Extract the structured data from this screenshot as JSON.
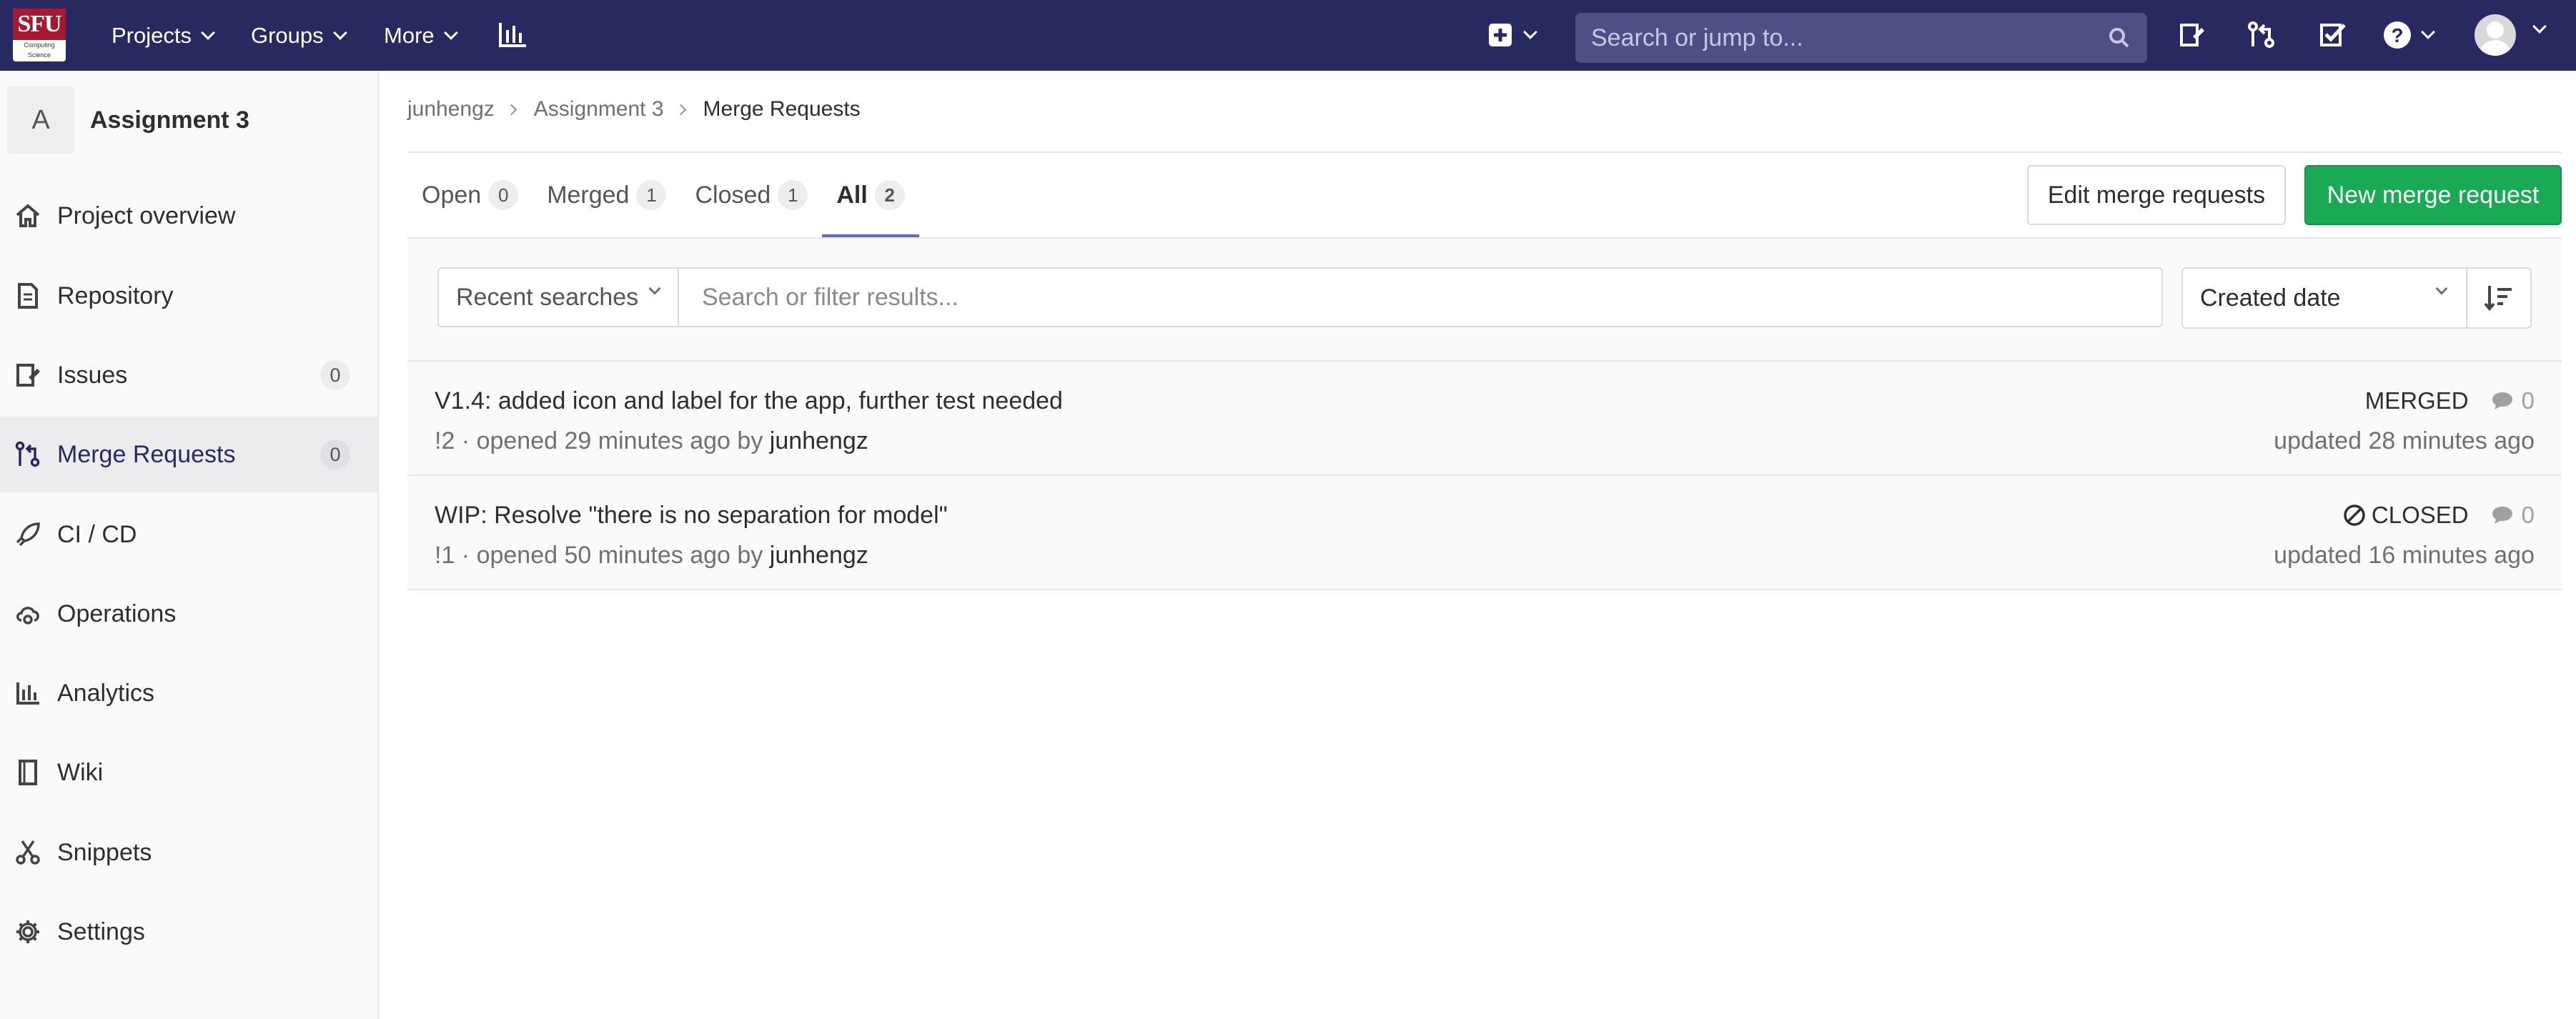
{
  "topbar": {
    "logo_text": "SFU",
    "logo_subtext": "Computing Science",
    "projects": "Projects",
    "groups": "Groups",
    "more": "More",
    "search_placeholder": "Search or jump to..."
  },
  "sidebar": {
    "project_letter": "A",
    "project_name": "Assignment 3",
    "items": [
      {
        "label": "Project overview",
        "icon": "home-icon"
      },
      {
        "label": "Repository",
        "icon": "document-icon"
      },
      {
        "label": "Issues",
        "icon": "issues-icon",
        "badge": "0"
      },
      {
        "label": "Merge Requests",
        "icon": "merge-request-icon",
        "badge": "0",
        "active": true
      },
      {
        "label": "CI / CD",
        "icon": "rocket-icon"
      },
      {
        "label": "Operations",
        "icon": "cloud-gear-icon"
      },
      {
        "label": "Analytics",
        "icon": "bar-chart-icon"
      },
      {
        "label": "Wiki",
        "icon": "book-icon"
      },
      {
        "label": "Snippets",
        "icon": "scissors-icon"
      },
      {
        "label": "Settings",
        "icon": "gear-icon"
      }
    ]
  },
  "breadcrumb": {
    "user": "junhengz",
    "project": "Assignment 3",
    "current": "Merge Requests"
  },
  "tabs": [
    {
      "label": "Open",
      "count": "0"
    },
    {
      "label": "Merged",
      "count": "1"
    },
    {
      "label": "Closed",
      "count": "1"
    },
    {
      "label": "All",
      "count": "2",
      "active": true
    }
  ],
  "actions": {
    "edit": "Edit merge requests",
    "new": "New merge request"
  },
  "filter": {
    "recent": "Recent searches",
    "placeholder": "Search or filter results...",
    "sort": "Created date"
  },
  "merge_requests": [
    {
      "title": "V1.4: added icon and label for the app, further test needed",
      "meta": "!2 · opened 29 minutes ago by ",
      "author": "junhengz",
      "status": "MERGED",
      "comments": "0",
      "updated": "updated 28 minutes ago"
    },
    {
      "title": "WIP: Resolve \"there is no separation for model\"",
      "meta": "!1 · opened 50 minutes ago by ",
      "author": "junhengz",
      "status": "CLOSED",
      "comments": "0",
      "updated": "updated 16 minutes ago"
    }
  ],
  "colors": {
    "topbar": "#292961",
    "accent": "#6666c4",
    "new_button": "#1aaa55"
  }
}
